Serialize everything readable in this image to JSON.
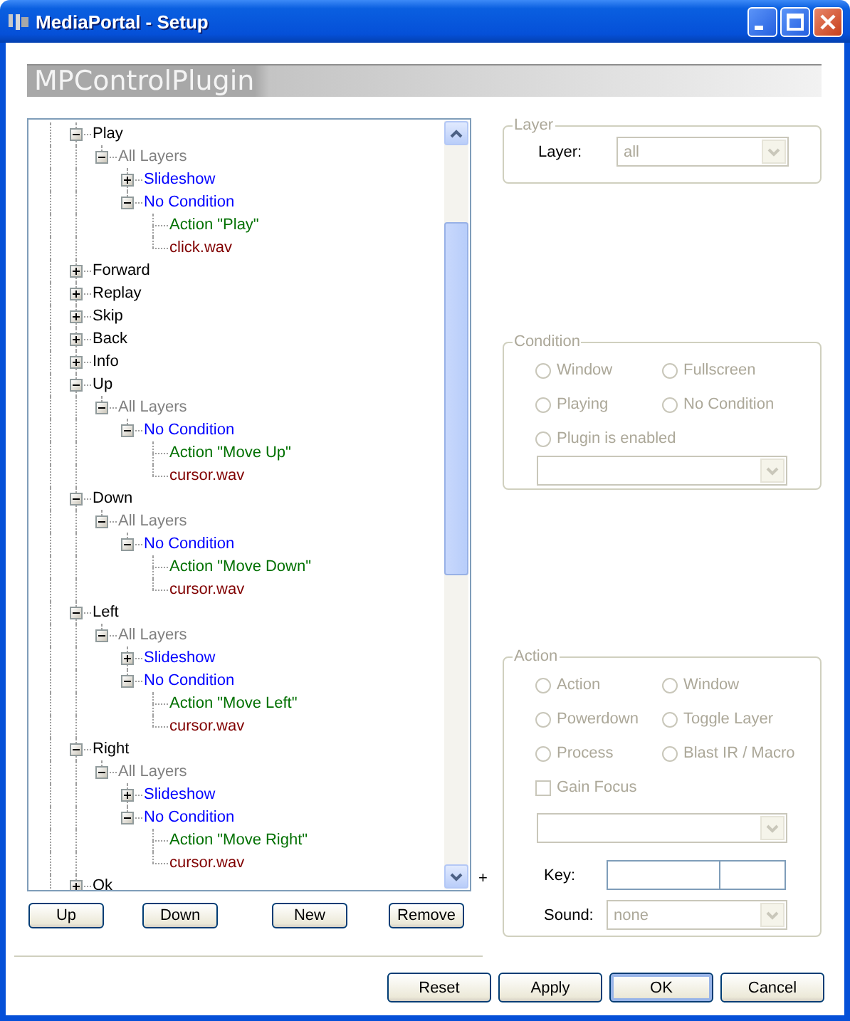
{
  "window": {
    "title": "MediaPortal - Setup"
  },
  "banner": {
    "title": "MPControlPlugin"
  },
  "tree": {
    "items": [
      {
        "label": "Play",
        "kind": "command",
        "expanded": true,
        "children": [
          {
            "label": "All Layers",
            "kind": "layer",
            "expanded": true,
            "children": [
              {
                "label": "Slideshow",
                "kind": "condition",
                "expanded": false
              },
              {
                "label": "No Condition",
                "kind": "condition",
                "expanded": true,
                "children": [
                  {
                    "label": "Action \"Play\"",
                    "kind": "action"
                  },
                  {
                    "label": "click.wav",
                    "kind": "sound"
                  }
                ]
              }
            ]
          }
        ]
      },
      {
        "label": "Forward",
        "kind": "command",
        "expanded": false
      },
      {
        "label": "Replay",
        "kind": "command",
        "expanded": false
      },
      {
        "label": "Skip",
        "kind": "command",
        "expanded": false
      },
      {
        "label": "Back",
        "kind": "command",
        "expanded": false
      },
      {
        "label": "Info",
        "kind": "command",
        "expanded": false
      },
      {
        "label": "Up",
        "kind": "command",
        "expanded": true,
        "children": [
          {
            "label": "All Layers",
            "kind": "layer",
            "expanded": true,
            "children": [
              {
                "label": "No Condition",
                "kind": "condition",
                "expanded": true,
                "children": [
                  {
                    "label": "Action \"Move Up\"",
                    "kind": "action"
                  },
                  {
                    "label": "cursor.wav",
                    "kind": "sound"
                  }
                ]
              }
            ]
          }
        ]
      },
      {
        "label": "Down",
        "kind": "command",
        "expanded": true,
        "children": [
          {
            "label": "All Layers",
            "kind": "layer",
            "expanded": true,
            "children": [
              {
                "label": "No Condition",
                "kind": "condition",
                "expanded": true,
                "children": [
                  {
                    "label": "Action \"Move Down\"",
                    "kind": "action"
                  },
                  {
                    "label": "cursor.wav",
                    "kind": "sound"
                  }
                ]
              }
            ]
          }
        ]
      },
      {
        "label": "Left",
        "kind": "command",
        "expanded": true,
        "children": [
          {
            "label": "All Layers",
            "kind": "layer",
            "expanded": true,
            "children": [
              {
                "label": "Slideshow",
                "kind": "condition",
                "expanded": false
              },
              {
                "label": "No Condition",
                "kind": "condition",
                "expanded": true,
                "children": [
                  {
                    "label": "Action \"Move Left\"",
                    "kind": "action"
                  },
                  {
                    "label": "cursor.wav",
                    "kind": "sound"
                  }
                ]
              }
            ]
          }
        ]
      },
      {
        "label": "Right",
        "kind": "command",
        "expanded": true,
        "children": [
          {
            "label": "All Layers",
            "kind": "layer",
            "expanded": true,
            "children": [
              {
                "label": "Slideshow",
                "kind": "condition",
                "expanded": false
              },
              {
                "label": "No Condition",
                "kind": "condition",
                "expanded": true,
                "children": [
                  {
                    "label": "Action \"Move Right\"",
                    "kind": "action"
                  },
                  {
                    "label": "cursor.wav",
                    "kind": "sound"
                  }
                ]
              }
            ]
          }
        ]
      },
      {
        "label": "Ok",
        "kind": "command",
        "expanded": false
      }
    ]
  },
  "tree_buttons": [
    "Up",
    "Down",
    "New",
    "Remove"
  ],
  "stray_mark": "+",
  "layer_group": {
    "title": "Layer",
    "disabled": true,
    "label": "Layer:",
    "value": "all"
  },
  "condition_group": {
    "title": "Condition",
    "disabled": true,
    "options": [
      {
        "label": "Window",
        "selected": false
      },
      {
        "label": "Fullscreen",
        "selected": false
      },
      {
        "label": "Playing",
        "selected": false
      },
      {
        "label": "No Condition",
        "selected": false
      },
      {
        "label": "Plugin is enabled",
        "selected": false
      }
    ]
  },
  "action_group": {
    "title": "Action",
    "disabled": true,
    "options": [
      {
        "label": "Action",
        "selected": false
      },
      {
        "label": "Window",
        "selected": false
      },
      {
        "label": "Powerdown",
        "selected": false
      },
      {
        "label": "Toggle Layer",
        "selected": false
      },
      {
        "label": "Process",
        "selected": false
      },
      {
        "label": "Blast IR / Macro",
        "selected": false
      }
    ],
    "gain_focus": {
      "label": "Gain Focus",
      "checked": false
    },
    "key_label": "Key:",
    "sound": {
      "label": "Sound:",
      "value": "none"
    }
  },
  "dialog_buttons": [
    {
      "label": "Reset",
      "default": false
    },
    {
      "label": "Apply",
      "default": false
    },
    {
      "label": "OK",
      "default": true
    },
    {
      "label": "Cancel",
      "default": false
    }
  ]
}
